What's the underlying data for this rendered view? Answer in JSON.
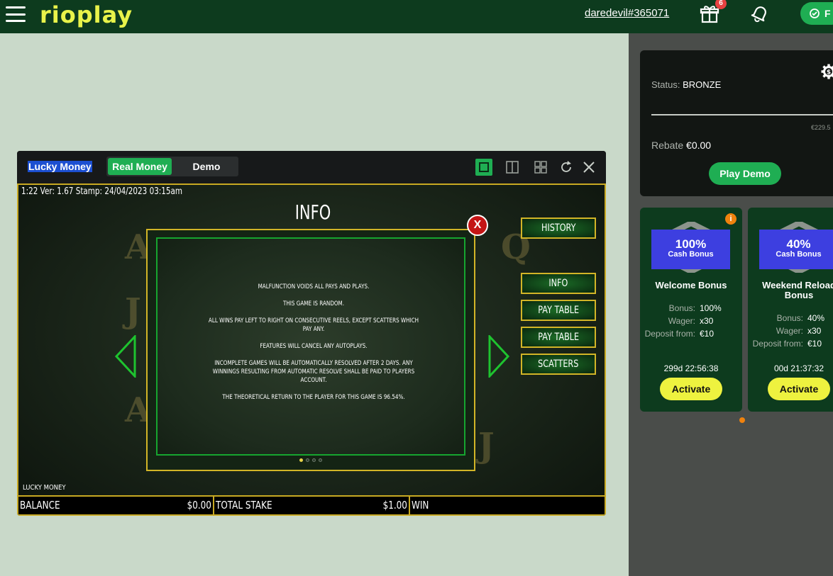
{
  "header": {
    "logo": "rioplay",
    "username": "daredevil#365071",
    "gift_badge": "6",
    "pill_label": "F"
  },
  "status_card": {
    "status_label": "Status:",
    "status_value": "BRONZE",
    "progress_value": "€229.5",
    "rebate_label": "Rebate",
    "rebate_value": "€0.00",
    "play_demo": "Play Demo"
  },
  "bonuses": [
    {
      "percent": "100%",
      "type": "Cash Bonus",
      "title": "Welcome Bonus",
      "details": [
        {
          "k": "Bonus:",
          "v": "100%"
        },
        {
          "k": "Wager:",
          "v": "x30"
        },
        {
          "k": "Deposit from:",
          "v": "€10"
        }
      ],
      "timer": "299d  22:56:38",
      "activate": "Activate",
      "info": "i"
    },
    {
      "percent": "40%",
      "type": "Cash Bonus",
      "title": "Weekend Reload Bonus",
      "details": [
        {
          "k": "Bonus:",
          "v": "40%"
        },
        {
          "k": "Wager:",
          "v": "x30"
        },
        {
          "k": "Deposit from:",
          "v": "€10"
        }
      ],
      "timer": "00d  21:37:32",
      "activate": "Activate"
    }
  ],
  "game": {
    "title": "Lucky Money",
    "mode_real": "Real Money",
    "mode_demo": "Demo",
    "status_line": "1:22   Ver: 1.67 Stamp: 24/04/2023 03:15am",
    "info_heading": "INFO",
    "info_lines": [
      "MALFUNCTION VOIDS ALL PAYS AND PLAYS.",
      "THIS GAME IS RANDOM.",
      "ALL WINS PAY LEFT TO RIGHT ON CONSECUTIVE REELS, EXCEPT SCATTERS WHICH PAY ANY.",
      "FEATURES WILL CANCEL ANY AUTOPLAYS.",
      "INCOMPLETE GAMES WILL BE AUTOMATICALLY RESOLVED AFTER 2 DAYS. ANY WINNINGS RESULTING FROM AUTOMATIC RESOLVE SHALL BE PAID TO PLAYERS ACCOUNT.",
      "THE THEORETICAL RETURN TO THE PLAYER FOR THIS GAME IS 96.54%."
    ],
    "side_buttons": [
      "HISTORY",
      "INFO",
      "PAY TABLE",
      "PAY TABLE",
      "SCATTERS"
    ],
    "close": "X",
    "footer_name": "LUCKY MONEY",
    "balance_label": "BALANCE",
    "balance_value": "$0.00",
    "stake_label": "TOTAL STAKE",
    "stake_value": "$1.00",
    "win_label": "WIN"
  }
}
